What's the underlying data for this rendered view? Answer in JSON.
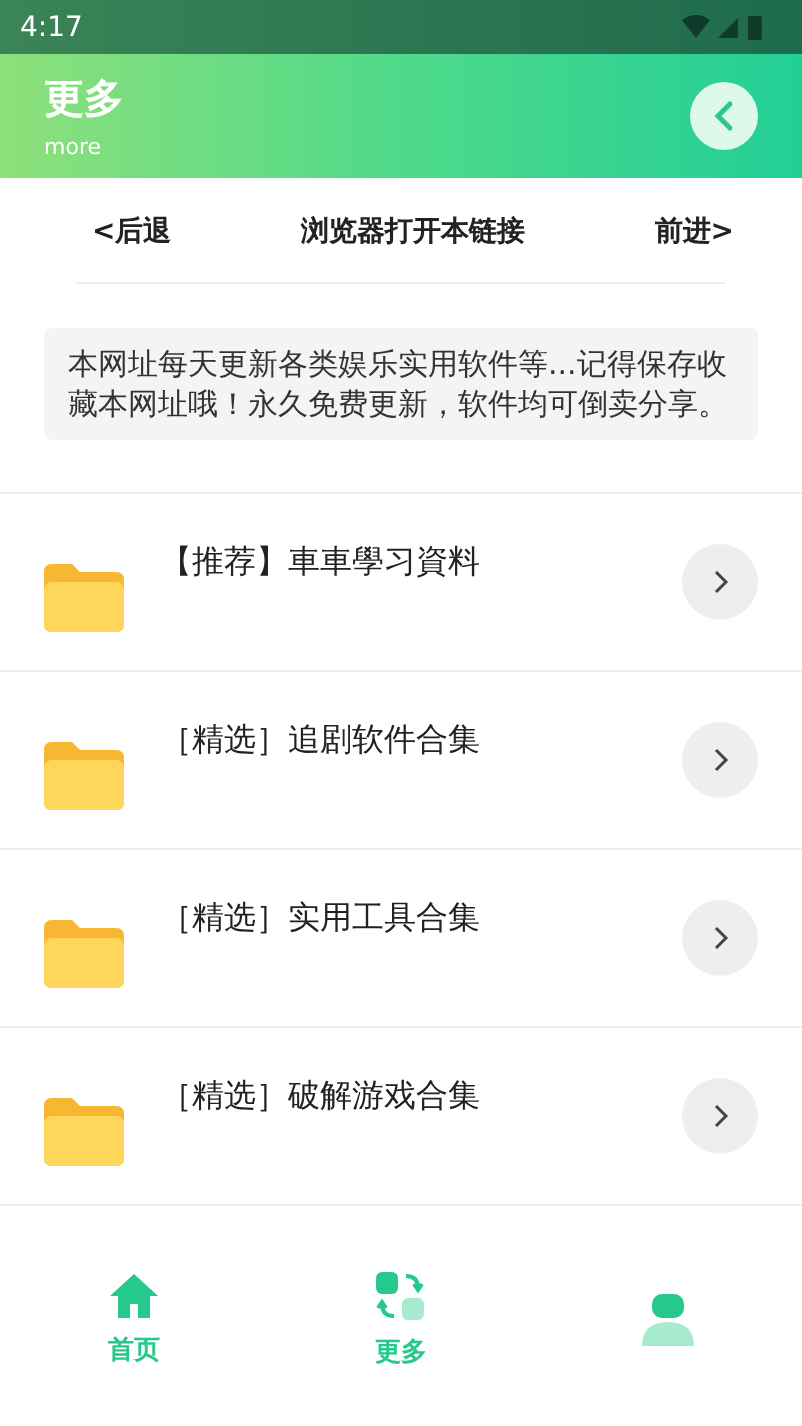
{
  "status_bar": {
    "time": "4:17"
  },
  "header": {
    "title": "更多",
    "subtitle": "more"
  },
  "nav": {
    "back": "<后退",
    "open": "浏览器打开本链接",
    "forward": "前进>"
  },
  "notice": "本网址每天更新各类娱乐实用软件等...记得保存收藏本网址哦！永久免费更新，软件均可倒卖分享。",
  "items": [
    {
      "label": "【推荐】車車學习資料"
    },
    {
      "label": "［精选］追剧软件合集"
    },
    {
      "label": "［精选］实用工具合集"
    },
    {
      "label": "［精选］破解游戏合集"
    }
  ],
  "tabs": [
    {
      "kind": "home",
      "label": "首页"
    },
    {
      "kind": "swap",
      "label": "更多"
    },
    {
      "kind": "person"
    }
  ]
}
